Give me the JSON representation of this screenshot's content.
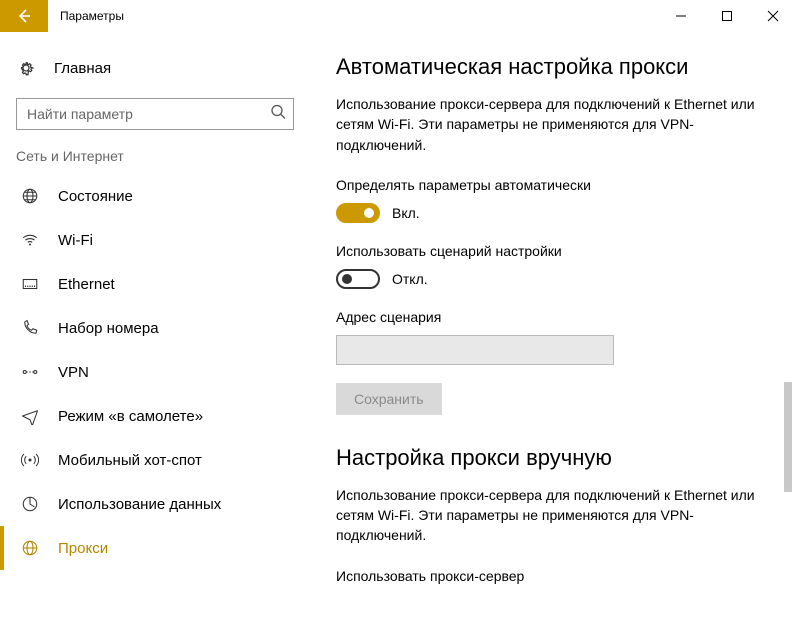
{
  "titlebar": {
    "title": "Параметры"
  },
  "sidebar": {
    "home": "Главная",
    "search_placeholder": "Найти параметр",
    "group": "Сеть и Интернет",
    "items": [
      {
        "label": "Состояние"
      },
      {
        "label": "Wi-Fi"
      },
      {
        "label": "Ethernet"
      },
      {
        "label": "Набор номера"
      },
      {
        "label": "VPN"
      },
      {
        "label": "Режим «в самолете»"
      },
      {
        "label": "Мобильный хот-спот"
      },
      {
        "label": "Использование данных"
      },
      {
        "label": "Прокси"
      }
    ]
  },
  "content": {
    "auto_heading": "Автоматическая настройка прокси",
    "auto_desc": "Использование прокси-сервера для подключений к Ethernet или сетям Wi-Fi. Эти параметры не применяются для VPN-подключений.",
    "auto_detect_label": "Определять параметры автоматически",
    "auto_detect_state": "Вкл.",
    "use_script_label": "Использовать сценарий настройки",
    "use_script_state": "Откл.",
    "script_addr_label": "Адрес сценария",
    "save_btn": "Сохранить",
    "manual_heading": "Настройка прокси вручную",
    "manual_desc": "Использование прокси-сервера для подключений к Ethernet или сетям Wi-Fi. Эти параметры не применяются для VPN-подключений.",
    "use_proxy_label": "Использовать прокси-сервер"
  },
  "colors": {
    "accent": "#cc9a00"
  }
}
